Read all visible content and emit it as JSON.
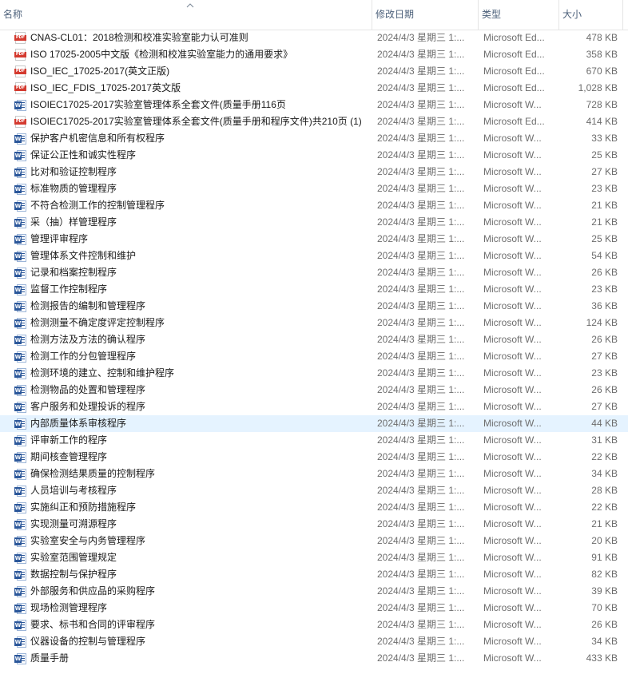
{
  "columns": {
    "name": "名称",
    "date": "修改日期",
    "type": "类型",
    "size": "大小"
  },
  "sort_indicator": "chevron-up-icon",
  "selected_row_index": 23,
  "colors": {
    "selected_row": "#e5f3ff",
    "header_text": "#4c607a",
    "pdf_icon": "#d43a2f",
    "word_icon": "#2b579a"
  },
  "files": [
    {
      "icon": "pdf-icon",
      "name": "CNAS-CL01：2018检测和校准实验室能力认可准则",
      "date": "2024/4/3 星期三 1:...",
      "type": "Microsoft Ed...",
      "size": "478 KB"
    },
    {
      "icon": "pdf-icon",
      "name": "ISO 17025-2005中文版《检测和校准实验室能力的通用要求》",
      "date": "2024/4/3 星期三 1:...",
      "type": "Microsoft Ed...",
      "size": "358 KB"
    },
    {
      "icon": "pdf-icon",
      "name": "ISO_IEC_17025-2017(英文正版)",
      "date": "2024/4/3 星期三 1:...",
      "type": "Microsoft Ed...",
      "size": "670 KB"
    },
    {
      "icon": "pdf-icon",
      "name": "ISO_IEC_FDIS_17025-2017英文版",
      "date": "2024/4/3 星期三 1:...",
      "type": "Microsoft Ed...",
      "size": "1,028 KB"
    },
    {
      "icon": "word-icon",
      "name": "ISOIEC17025-2017实验室管理体系全套文件(质量手册116页",
      "date": "2024/4/3 星期三 1:...",
      "type": "Microsoft W...",
      "size": "728 KB"
    },
    {
      "icon": "pdf-icon",
      "name": "ISOIEC17025-2017实验室管理体系全套文件(质量手册和程序文件)共210页 (1)",
      "date": "2024/4/3 星期三 1:...",
      "type": "Microsoft Ed...",
      "size": "414 KB"
    },
    {
      "icon": "word-icon",
      "name": "保护客户机密信息和所有权程序",
      "date": "2024/4/3 星期三 1:...",
      "type": "Microsoft W...",
      "size": "33 KB"
    },
    {
      "icon": "word-icon",
      "name": "保证公正性和诚实性程序",
      "date": "2024/4/3 星期三 1:...",
      "type": "Microsoft W...",
      "size": "25 KB"
    },
    {
      "icon": "word-icon",
      "name": "比对和验证控制程序",
      "date": "2024/4/3 星期三 1:...",
      "type": "Microsoft W...",
      "size": "27 KB"
    },
    {
      "icon": "word-icon",
      "name": "标准物质的管理程序",
      "date": "2024/4/3 星期三 1:...",
      "type": "Microsoft W...",
      "size": "23 KB"
    },
    {
      "icon": "word-icon",
      "name": "不符合检测工作的控制管理程序",
      "date": "2024/4/3 星期三 1:...",
      "type": "Microsoft W...",
      "size": "21 KB"
    },
    {
      "icon": "word-icon",
      "name": "采（抽）样管理程序",
      "date": "2024/4/3 星期三 1:...",
      "type": "Microsoft W...",
      "size": "21 KB"
    },
    {
      "icon": "word-icon",
      "name": "管理评审程序",
      "date": "2024/4/3 星期三 1:...",
      "type": "Microsoft W...",
      "size": "25 KB"
    },
    {
      "icon": "word-icon",
      "name": "管理体系文件控制和维护",
      "date": "2024/4/3 星期三 1:...",
      "type": "Microsoft W...",
      "size": "54 KB"
    },
    {
      "icon": "word-icon",
      "name": "记录和档案控制程序",
      "date": "2024/4/3 星期三 1:...",
      "type": "Microsoft W...",
      "size": "26 KB"
    },
    {
      "icon": "word-icon",
      "name": "监督工作控制程序",
      "date": "2024/4/3 星期三 1:...",
      "type": "Microsoft W...",
      "size": "23 KB"
    },
    {
      "icon": "word-icon",
      "name": "检测报告的编制和管理程序",
      "date": "2024/4/3 星期三 1:...",
      "type": "Microsoft W...",
      "size": "36 KB"
    },
    {
      "icon": "word-icon",
      "name": "检测测量不确定度评定控制程序",
      "date": "2024/4/3 星期三 1:...",
      "type": "Microsoft W...",
      "size": "124 KB"
    },
    {
      "icon": "word-icon",
      "name": "检测方法及方法的确认程序",
      "date": "2024/4/3 星期三 1:...",
      "type": "Microsoft W...",
      "size": "26 KB"
    },
    {
      "icon": "word-icon",
      "name": "检测工作的分包管理程序",
      "date": "2024/4/3 星期三 1:...",
      "type": "Microsoft W...",
      "size": "27 KB"
    },
    {
      "icon": "word-icon",
      "name": "检测环境的建立、控制和维护程序",
      "date": "2024/4/3 星期三 1:...",
      "type": "Microsoft W...",
      "size": "23 KB"
    },
    {
      "icon": "word-icon",
      "name": "检测物品的处置和管理程序",
      "date": "2024/4/3 星期三 1:...",
      "type": "Microsoft W...",
      "size": "26 KB"
    },
    {
      "icon": "word-icon",
      "name": "客户服务和处理投诉的程序",
      "date": "2024/4/3 星期三 1:...",
      "type": "Microsoft W...",
      "size": "27 KB"
    },
    {
      "icon": "word-icon",
      "name": "内部质量体系审核程序",
      "date": "2024/4/3 星期三 1:...",
      "type": "Microsoft W...",
      "size": "44 KB"
    },
    {
      "icon": "word-icon",
      "name": "评审新工作的程序",
      "date": "2024/4/3 星期三 1:...",
      "type": "Microsoft W...",
      "size": "31 KB"
    },
    {
      "icon": "word-icon",
      "name": "期间核查管理程序",
      "date": "2024/4/3 星期三 1:...",
      "type": "Microsoft W...",
      "size": "22 KB"
    },
    {
      "icon": "word-icon",
      "name": "确保检测结果质量的控制程序",
      "date": "2024/4/3 星期三 1:...",
      "type": "Microsoft W...",
      "size": "34 KB"
    },
    {
      "icon": "word-icon",
      "name": "人员培训与考核程序",
      "date": "2024/4/3 星期三 1:...",
      "type": "Microsoft W...",
      "size": "28 KB"
    },
    {
      "icon": "word-icon",
      "name": "实施纠正和预防措施程序",
      "date": "2024/4/3 星期三 1:...",
      "type": "Microsoft W...",
      "size": "22 KB"
    },
    {
      "icon": "word-icon",
      "name": "实现测量可溯源程序",
      "date": "2024/4/3 星期三 1:...",
      "type": "Microsoft W...",
      "size": "21 KB"
    },
    {
      "icon": "word-icon",
      "name": "实验室安全与内务管理程序",
      "date": "2024/4/3 星期三 1:...",
      "type": "Microsoft W...",
      "size": "20 KB"
    },
    {
      "icon": "word-icon",
      "name": "实验室范围管理规定",
      "date": "2024/4/3 星期三 1:...",
      "type": "Microsoft W...",
      "size": "91 KB"
    },
    {
      "icon": "word-icon",
      "name": "数据控制与保护程序",
      "date": "2024/4/3 星期三 1:...",
      "type": "Microsoft W...",
      "size": "82 KB"
    },
    {
      "icon": "word-icon",
      "name": "外部服务和供应品的采购程序",
      "date": "2024/4/3 星期三 1:...",
      "type": "Microsoft W...",
      "size": "39 KB"
    },
    {
      "icon": "word-icon",
      "name": "现场检测管理程序",
      "date": "2024/4/3 星期三 1:...",
      "type": "Microsoft W...",
      "size": "70 KB"
    },
    {
      "icon": "word-icon",
      "name": "要求、标书和合同的评审程序",
      "date": "2024/4/3 星期三 1:...",
      "type": "Microsoft W...",
      "size": "26 KB"
    },
    {
      "icon": "word-icon",
      "name": "仪器设备的控制与管理程序",
      "date": "2024/4/3 星期三 1:...",
      "type": "Microsoft W...",
      "size": "34 KB"
    },
    {
      "icon": "word-icon",
      "name": "质量手册",
      "date": "2024/4/3 星期三 1:...",
      "type": "Microsoft W...",
      "size": "433 KB"
    }
  ]
}
